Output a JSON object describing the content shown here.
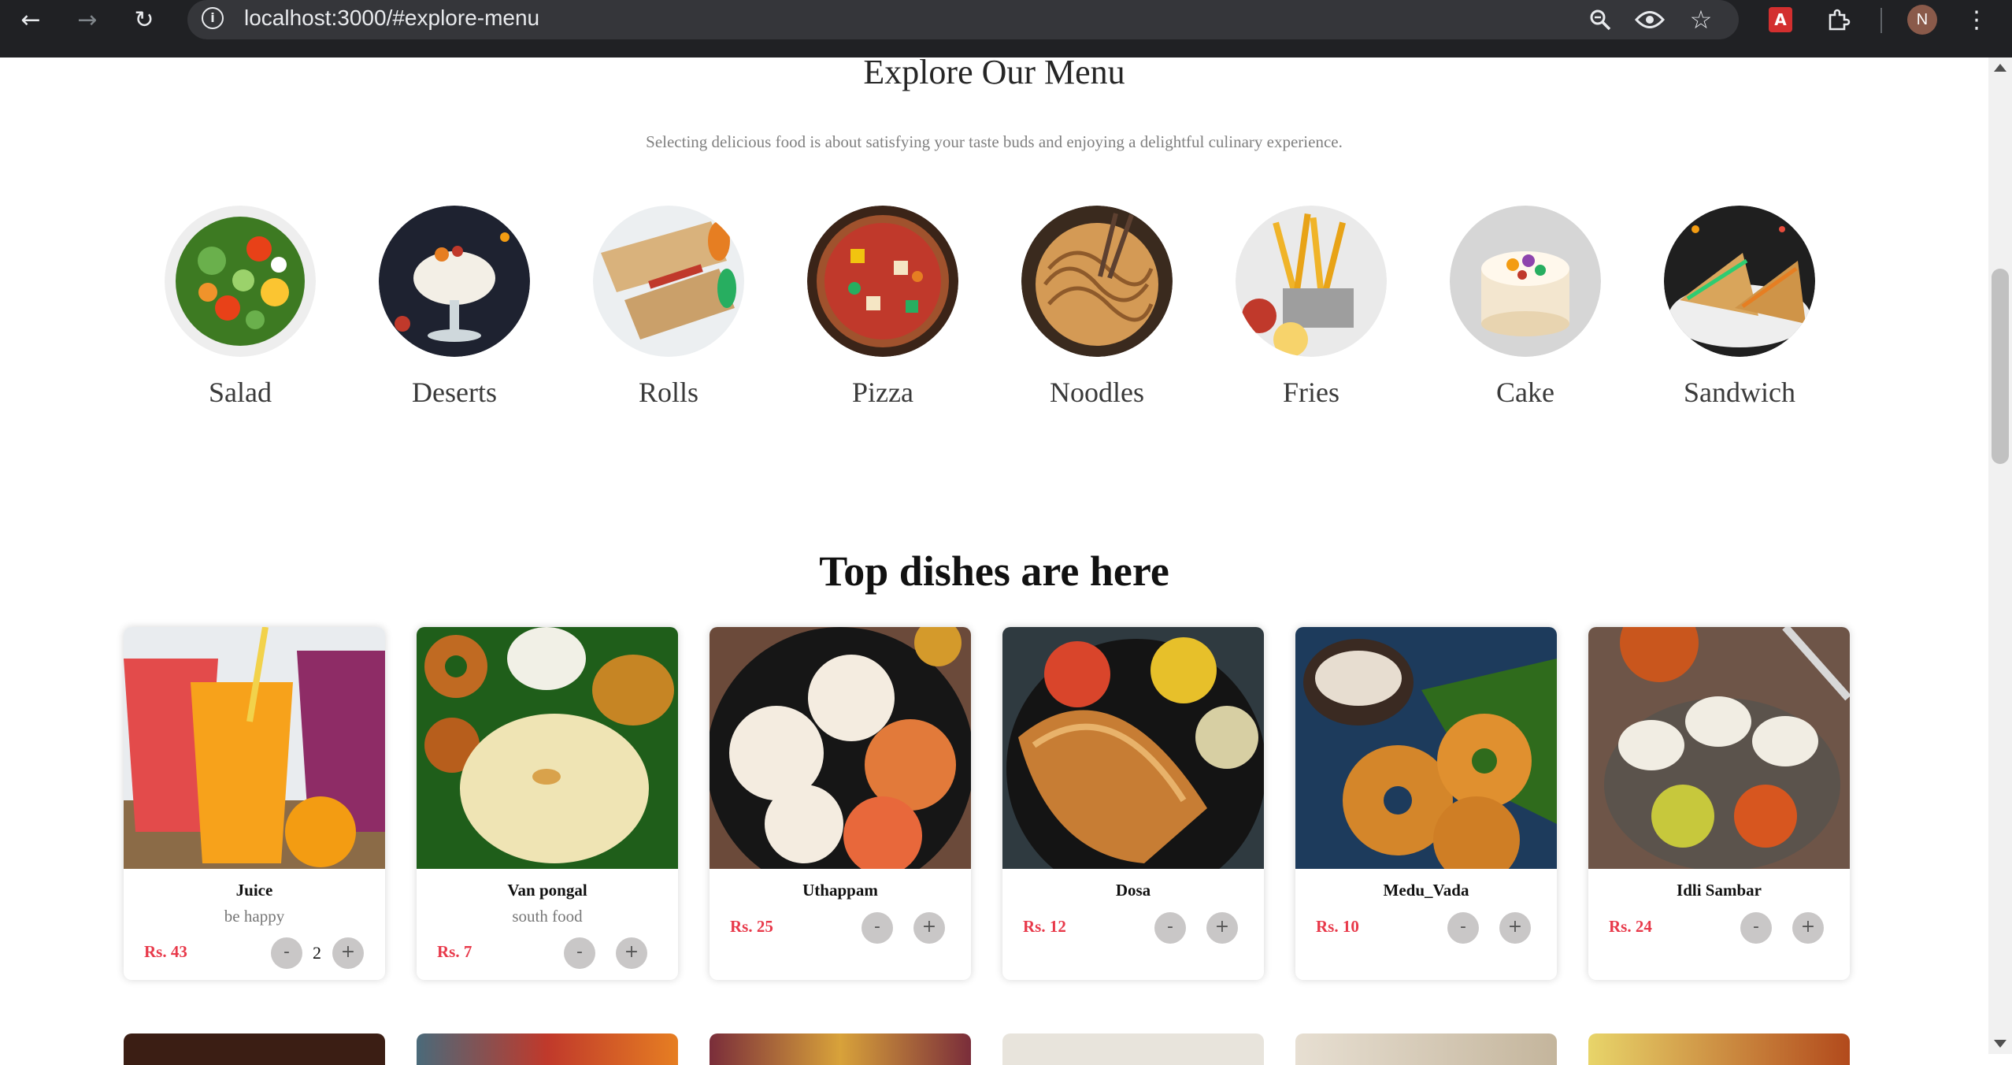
{
  "browser": {
    "url": "localhost:3000/#explore-menu",
    "profile_initial": "N",
    "pdf_label": "A"
  },
  "explore": {
    "title": "Explore Our Menu",
    "description": "Selecting delicious food is about satisfying your taste buds and enjoying a delightful culinary experience.",
    "categories": [
      {
        "label": "Salad"
      },
      {
        "label": "Deserts"
      },
      {
        "label": "Rolls"
      },
      {
        "label": "Pizza"
      },
      {
        "label": "Noodles"
      },
      {
        "label": "Fries"
      },
      {
        "label": "Cake"
      },
      {
        "label": "Sandwich"
      }
    ]
  },
  "top_dishes": {
    "title": "Top dishes are here",
    "items": [
      {
        "name": "Juice",
        "description": "be happy",
        "price": "Rs. 43",
        "quantity": "2"
      },
      {
        "name": "Van pongal",
        "description": "south food",
        "price": "Rs. 7"
      },
      {
        "name": "Uthappam",
        "price": "Rs. 25"
      },
      {
        "name": "Dosa",
        "price": "Rs. 12"
      },
      {
        "name": "Medu_Vada",
        "price": "Rs. 10"
      },
      {
        "name": "Idli Sambar",
        "price": "Rs. 24"
      }
    ]
  },
  "controls": {
    "minus": "-",
    "plus": "+"
  },
  "colors": {
    "price": "#e8394a",
    "chrome_bg": "#202124",
    "qty_button": "#c9c7c7"
  }
}
